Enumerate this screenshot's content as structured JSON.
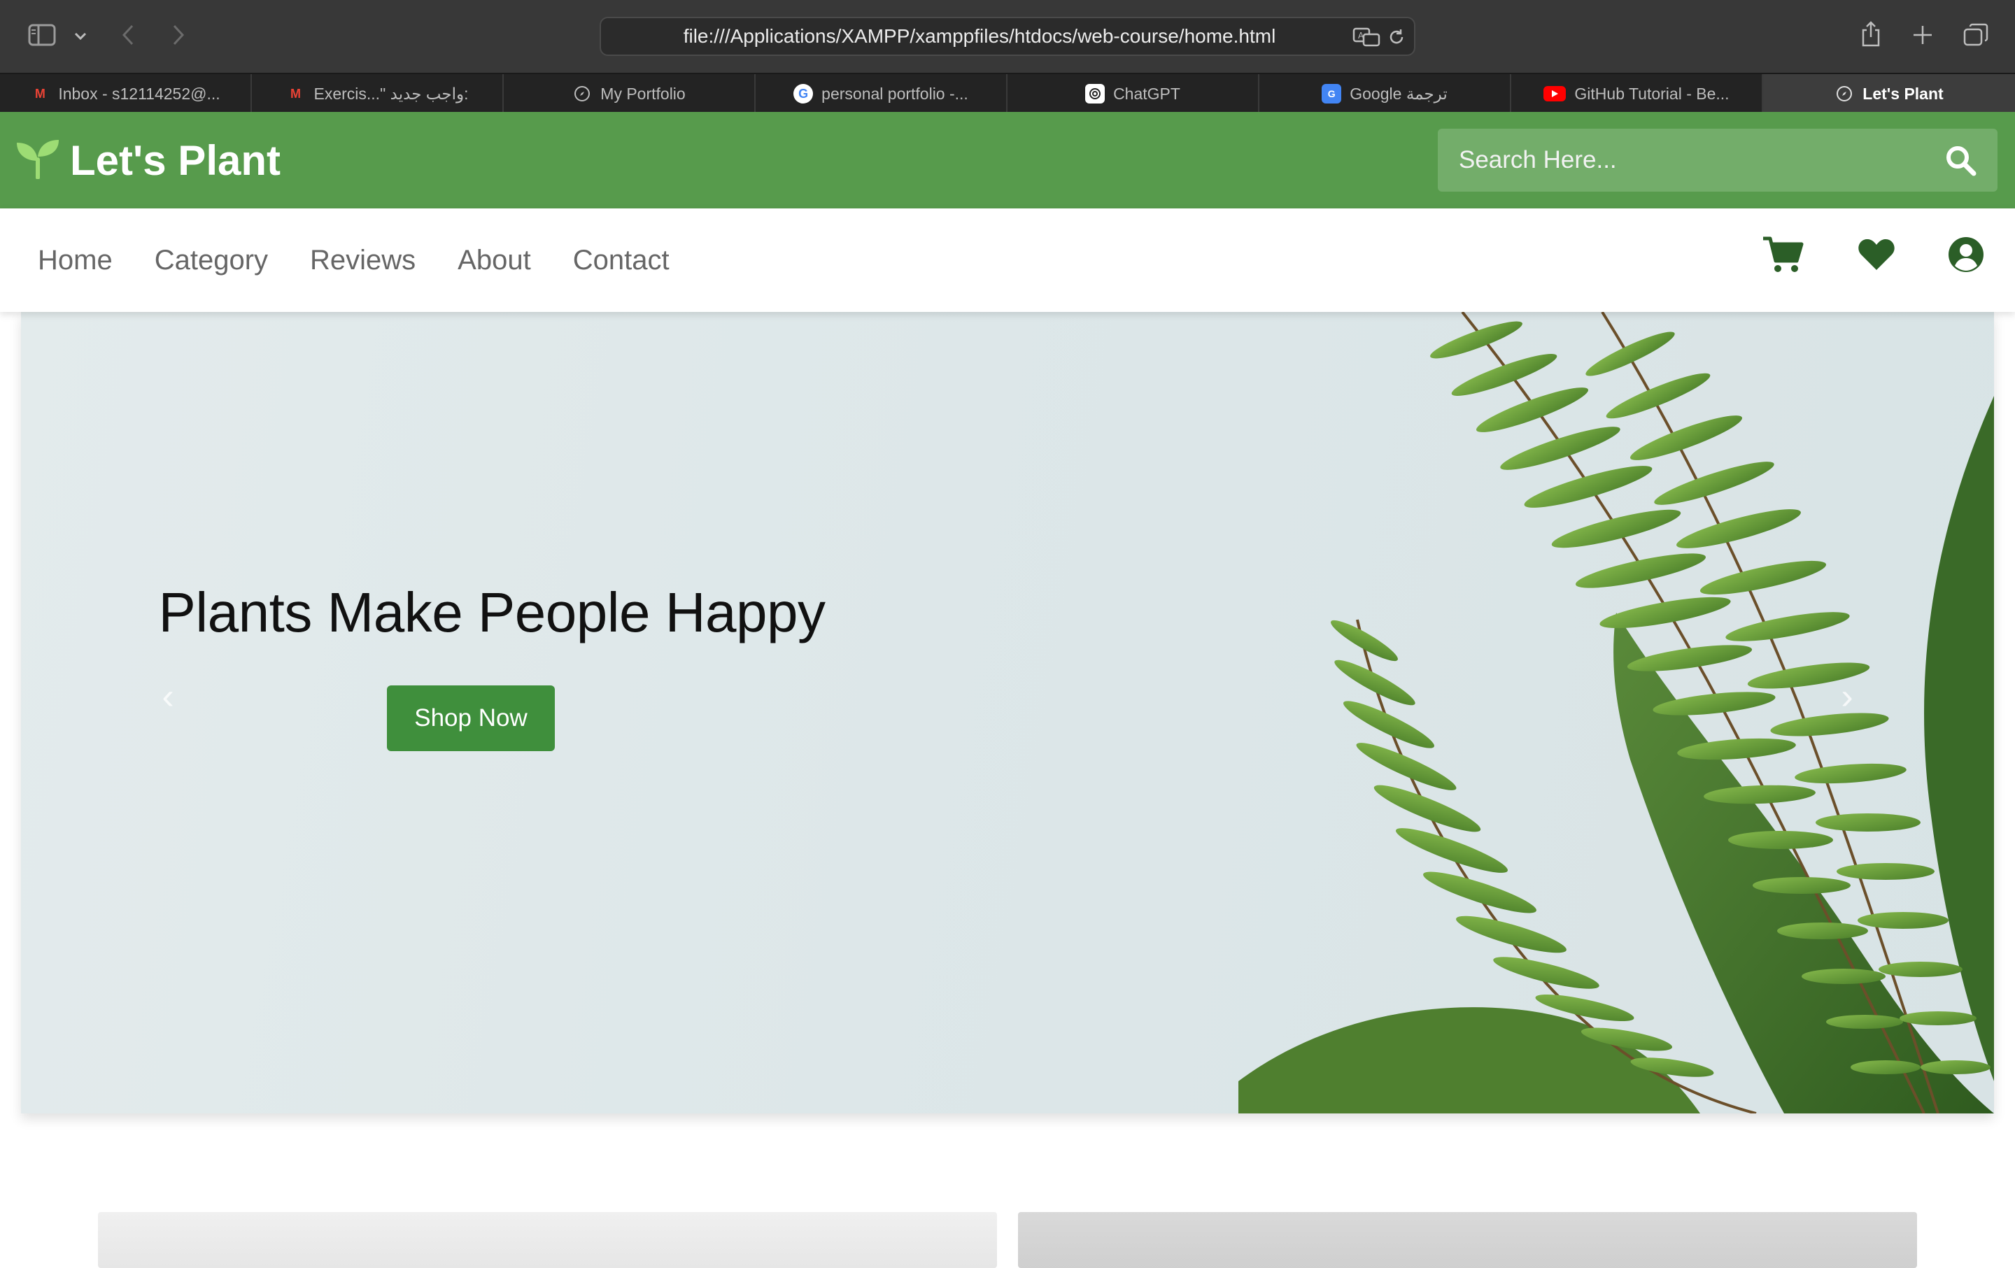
{
  "browser": {
    "url": "file:///Applications/XAMPP/xamppfiles/htdocs/web-course/home.html",
    "tabs": [
      {
        "label": "Inbox - s12114252@...",
        "icon": "gmail-icon"
      },
      {
        "label": "Exercis...\" واجب جديد:",
        "icon": "gmail-icon"
      },
      {
        "label": "My Portfolio",
        "icon": "compass-icon"
      },
      {
        "label": "personal portfolio -...",
        "icon": "google-icon"
      },
      {
        "label": "ChatGPT",
        "icon": "chatgpt-icon"
      },
      {
        "label": "Google ترجمة",
        "icon": "google-translate-icon"
      },
      {
        "label": "GitHub Tutorial - Be...",
        "icon": "youtube-icon"
      },
      {
        "label": "Let's Plant",
        "icon": "compass-icon",
        "active": true
      }
    ]
  },
  "header": {
    "logo_text": "Let's Plant",
    "logo_icon": "seedling-icon",
    "search_placeholder": "Search Here...",
    "search_value": "",
    "brand_color": "#579b4c"
  },
  "nav": {
    "links": [
      "Home",
      "Category",
      "Reviews",
      "About",
      "Contact"
    ],
    "icons": [
      "cart-icon",
      "heart-icon",
      "user-icon"
    ],
    "icon_color": "#2b5e27"
  },
  "hero": {
    "title": "Plants Make People Happy",
    "button_label": "Shop Now",
    "button_color": "#3f8f3c",
    "prev_glyph": "‹",
    "next_glyph": "›"
  }
}
